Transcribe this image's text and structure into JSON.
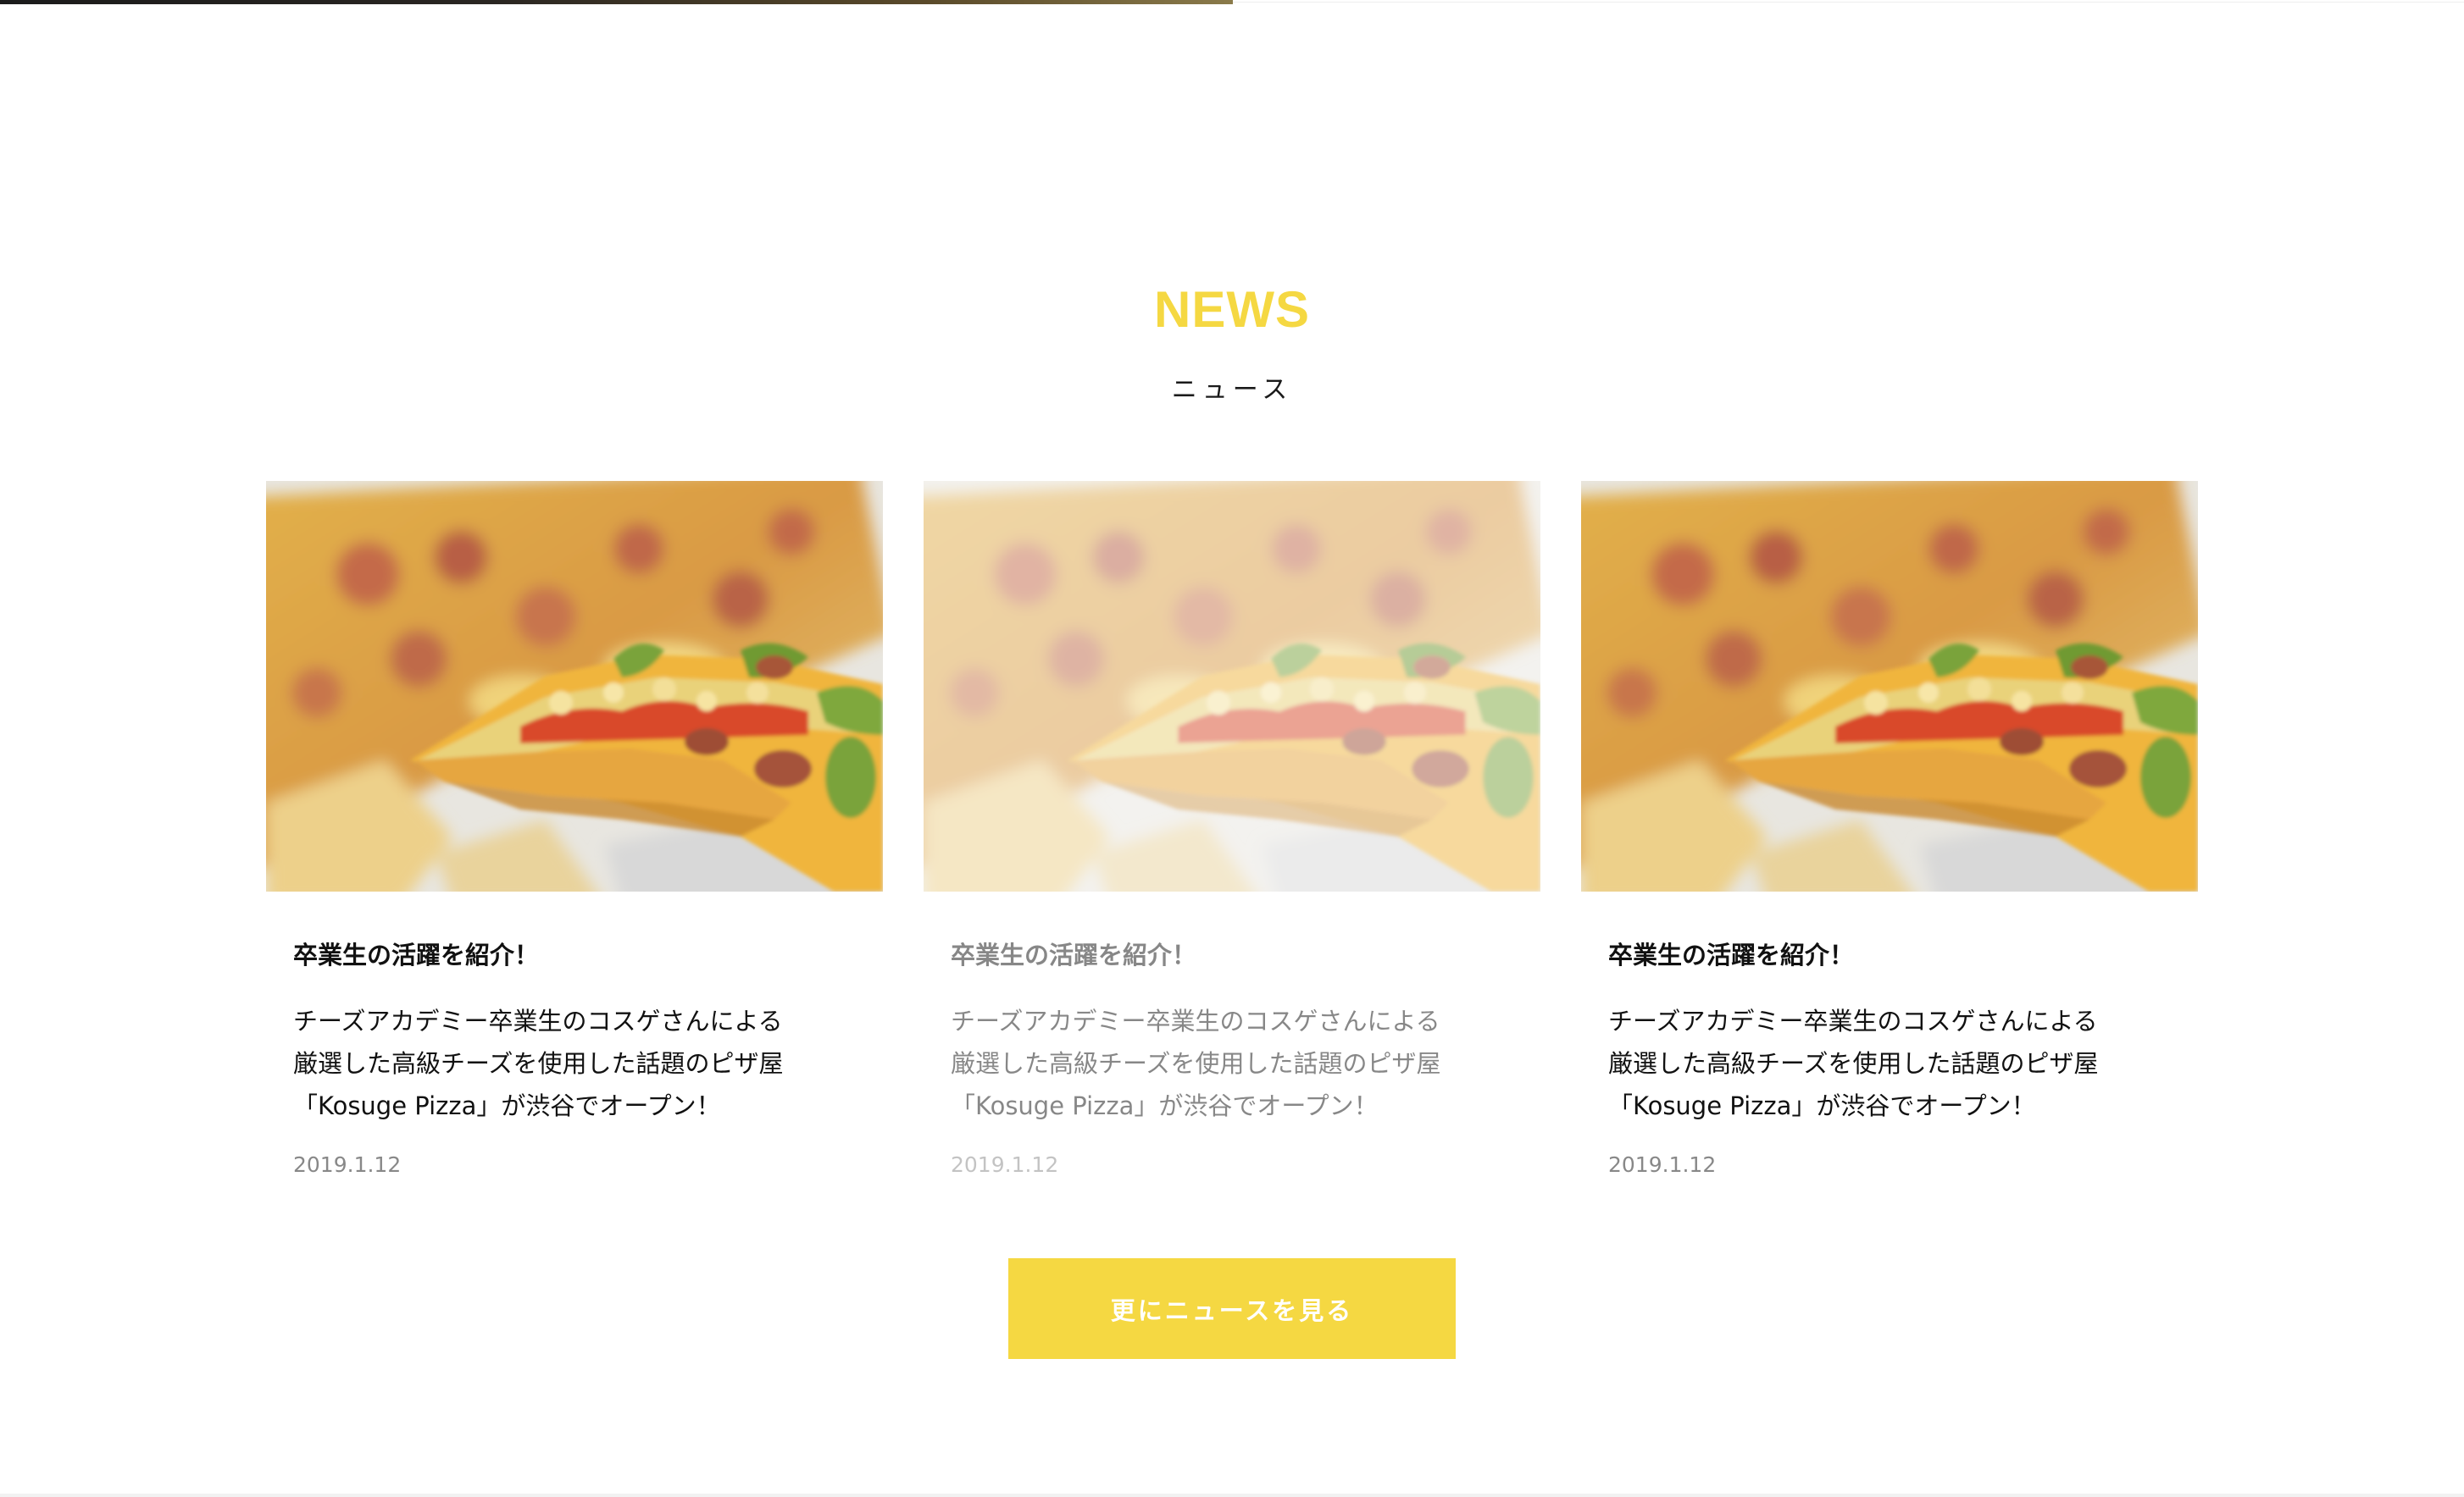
{
  "colors": {
    "accent": "#f5d842",
    "button_bg": "#f5d842",
    "button_text": "#ffffff",
    "text": "#111111",
    "date": "#888888"
  },
  "news": {
    "title": "NEWS",
    "subtitle": "ニュース",
    "cards": [
      {
        "image_icon": "pizza-photo",
        "title": "卒業生の活躍を紹介！",
        "text": "チーズアカデミー卒業生のコスゲさんによる\n厳選した高級チーズを使用した話題のピザ屋\n「Kosuge Pizza」が渋谷でオープン！",
        "date": "2019.1.12"
      },
      {
        "image_icon": "pizza-photo",
        "title": "卒業生の活躍を紹介！",
        "text": "チーズアカデミー卒業生のコスゲさんによる\n厳選した高級チーズを使用した話題のピザ屋\n「Kosuge Pizza」が渋谷でオープン！",
        "date": "2019.1.12"
      },
      {
        "image_icon": "pizza-photo",
        "title": "卒業生の活躍を紹介！",
        "text": "チーズアカデミー卒業生のコスゲさんによる\n厳選した高級チーズを使用した話題のピザ屋\n「Kosuge Pizza」が渋谷でオープン！",
        "date": "2019.1.12"
      }
    ],
    "more_button_label": "更にニュースを見る"
  }
}
